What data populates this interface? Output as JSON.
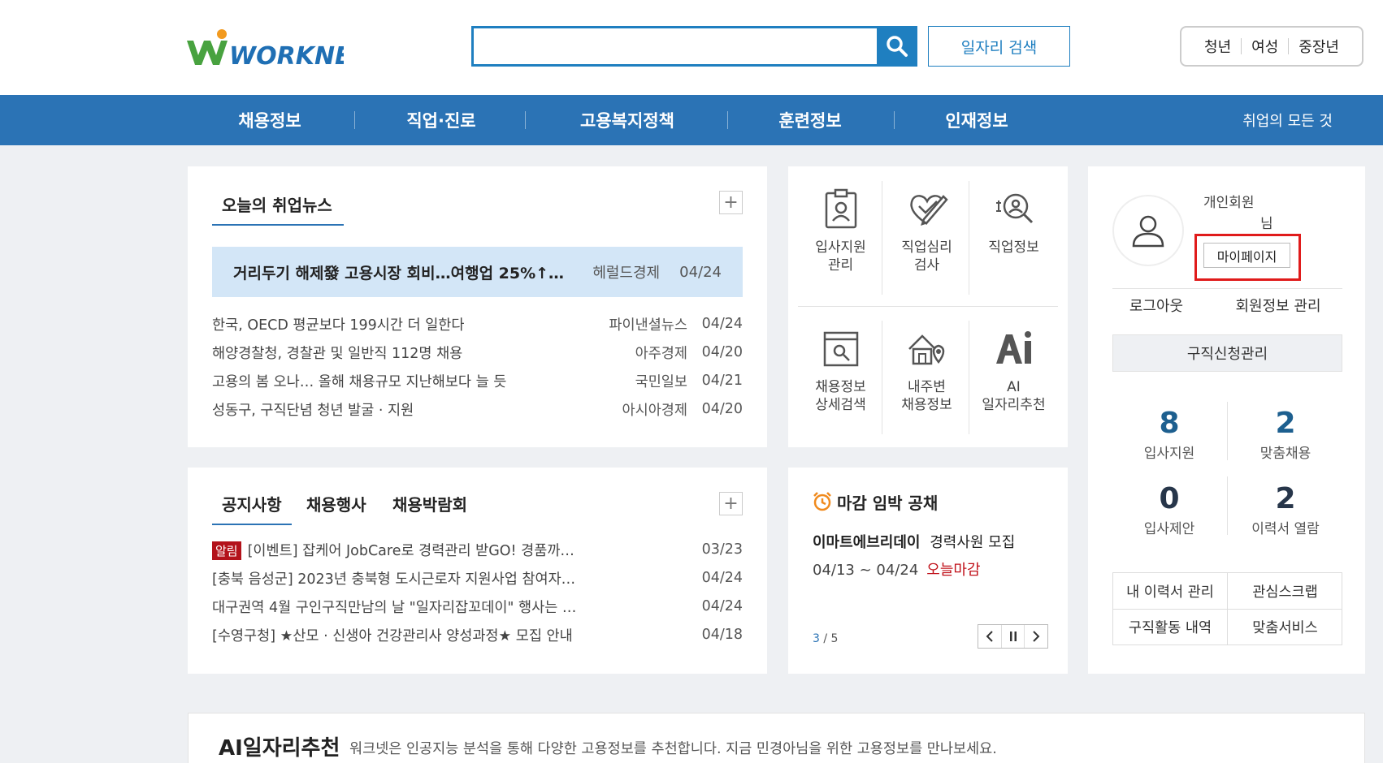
{
  "header": {
    "logo_text": "WORKNET",
    "search_placeholder": "",
    "job_search_label": "일자리 검색",
    "segments": [
      "청년",
      "여성",
      "중장년"
    ]
  },
  "nav": {
    "items": [
      "채용정보",
      "직업·진로",
      "고용복지정책",
      "훈련정보",
      "인재정보"
    ],
    "all_label": "취업의 모든 것"
  },
  "news": {
    "title": "오늘의 취업뉴스",
    "headline": {
      "title": "거리두기 해제發 고용시장 회비…여행업 25%↑…",
      "source": "헤럴드경제",
      "date": "04/24"
    },
    "items": [
      {
        "title": "한국, OECD 평균보다 199시간 더 일한다",
        "source": "파이낸셜뉴스",
        "date": "04/24"
      },
      {
        "title": "해양경찰청, 경찰관 및 일반직 112명 채용",
        "source": "아주경제",
        "date": "04/20"
      },
      {
        "title": "고용의 봄 오나… 올해 채용규모 지난해보다 늘 듯",
        "source": "국민일보",
        "date": "04/21"
      },
      {
        "title": "성동구, 구직단념 청년 발굴 · 지원",
        "source": "아시아경제",
        "date": "04/20"
      }
    ]
  },
  "quick": {
    "items": [
      {
        "label": "입사지원\n관리",
        "icon": "resume-clipboard-icon"
      },
      {
        "label": "직업심리\n검사",
        "icon": "heart-pencil-icon"
      },
      {
        "label": "직업정보",
        "icon": "search-person-icon"
      },
      {
        "label": "채용정보\n상세검색",
        "icon": "detail-search-icon"
      },
      {
        "label": "내주변\n채용정보",
        "icon": "nearby-map-icon"
      },
      {
        "label": "AI\n일자리추천",
        "icon": "ai-icon"
      }
    ]
  },
  "member": {
    "type": "개인회원",
    "nim": "님",
    "mypage_label": "마이페이지",
    "logout_label": "로그아웃",
    "profile_label": "회원정보 관리",
    "apply_mgmt_label": "구직신청관리",
    "stats": [
      {
        "value": "8",
        "label": "입사지원"
      },
      {
        "value": "2",
        "label": "맞춤채용"
      },
      {
        "value": "0",
        "label": "입사제안"
      },
      {
        "value": "2",
        "label": "이력서 열람"
      }
    ],
    "links": [
      "내 이력서 관리",
      "관심스크랩",
      "구직활동 내역",
      "맞춤서비스"
    ]
  },
  "notice": {
    "tabs": [
      "공지사항",
      "채용행사",
      "채용박람회"
    ],
    "badge": "알림",
    "items": [
      {
        "title": "[이벤트] 잡케어 JobCare로 경력관리 받GO! 경품까…",
        "date": "03/23"
      },
      {
        "title": "[충북 음성군] 2023년 충북형 도시근로자 지원사업 참여자…",
        "date": "04/24"
      },
      {
        "title": "대구권역 4월 구인구직만남의 날 \"일자리잡꼬데이\" 행사는 …",
        "date": "04/24"
      },
      {
        "title": "[수영구청] ★산모 · 신생아 건강관리사 양성과정★ 모집 안내",
        "date": "04/18"
      }
    ]
  },
  "deadline": {
    "title": "마감 임박 공채",
    "company": "이마트에브리데이",
    "position": "경력사원 모집",
    "period": "04/13 ~ 04/24",
    "today": "오늘마감",
    "page_current": "3",
    "page_total": "/ 5"
  },
  "ai": {
    "title": "AI일자리추천",
    "desc": "워크넷은 인공지능 분석을 통해 다양한 고용정보를 추천합니다. 지금 민경아님을 위한 고용정보를 만나보세요."
  },
  "colors": {
    "primary": "#2b73b5",
    "highlight_frame": "#e01b1b",
    "deadline_red": "#c0111a",
    "badge": "#b3121b"
  }
}
